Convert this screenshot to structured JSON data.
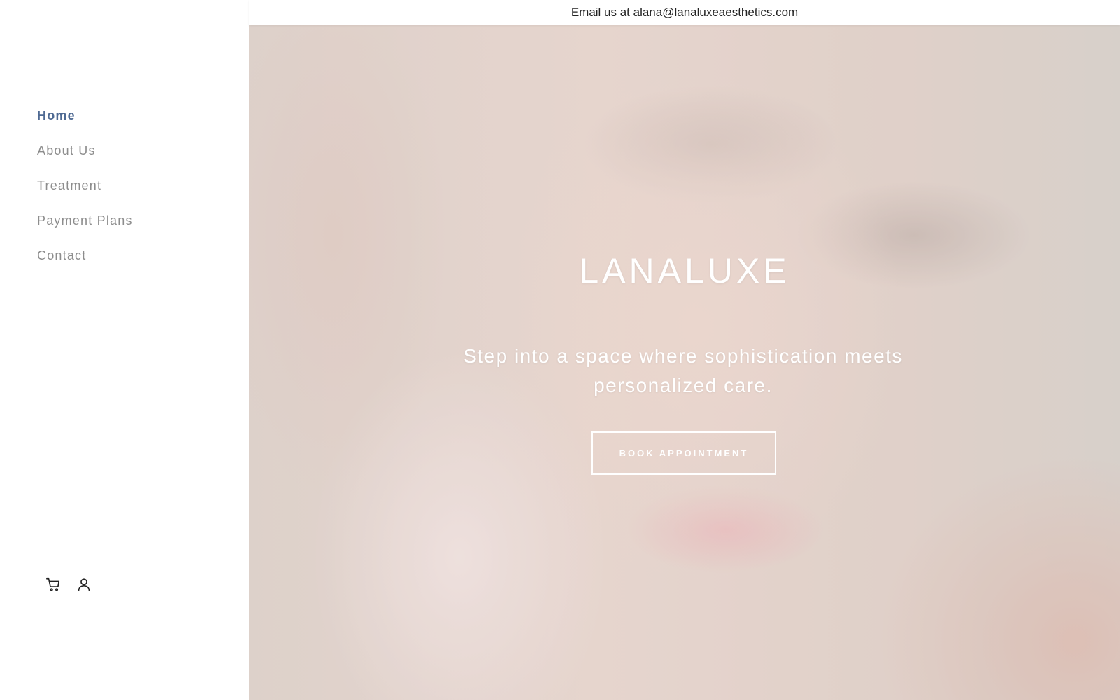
{
  "topbar": {
    "email_text": "Email us at alana@lanaluxeaesthetics.com"
  },
  "sidebar": {
    "nav_items": [
      {
        "label": "Home",
        "active": true
      },
      {
        "label": "About Us",
        "active": false
      },
      {
        "label": "Treatment",
        "active": false
      },
      {
        "label": "Payment Plans",
        "active": false
      },
      {
        "label": "Contact",
        "active": false
      }
    ],
    "icons": [
      "cart-icon",
      "user-icon"
    ]
  },
  "hero": {
    "brand": "LANALUXE",
    "tagline": "Step into a space where sophistication meets personalized care.",
    "cta_label": "BOOK APPOINTMENT"
  },
  "colors": {
    "active_nav": "#4f6a93",
    "inactive_nav": "#8d8d8d",
    "hero_text": "#ffffff"
  }
}
